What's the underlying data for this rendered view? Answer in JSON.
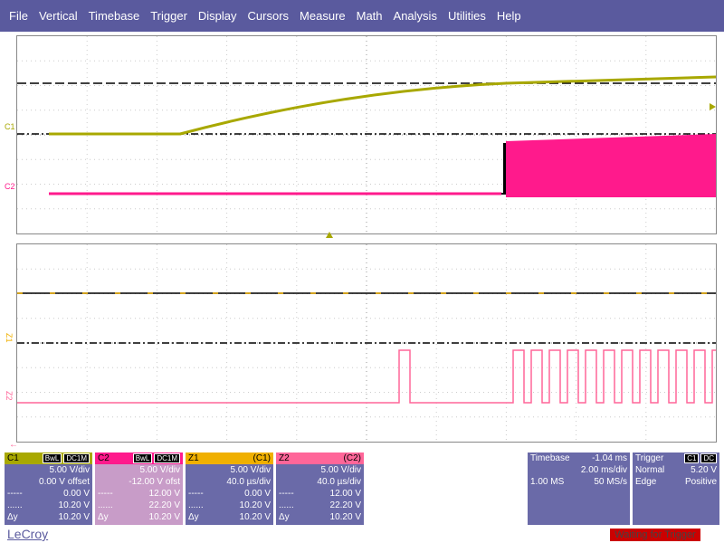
{
  "menu": [
    "File",
    "Vertical",
    "Timebase",
    "Trigger",
    "Display",
    "Cursors",
    "Measure",
    "Math",
    "Analysis",
    "Utilities",
    "Help"
  ],
  "labels": {
    "c1": "C1",
    "c2": "C2",
    "z1": "Z1",
    "z2": "Z2"
  },
  "colors": {
    "c1": "#a8a800",
    "c2": "#ff1a8c",
    "z1": "#f0b000",
    "z2": "#ff6699",
    "menu": "#5a5a9e"
  },
  "channels": [
    {
      "id": "c1",
      "title": "C1",
      "tags": [
        "BwL",
        "DC1M"
      ],
      "rows": [
        [
          "",
          "5.00 V/div"
        ],
        [
          "",
          "0.00 V offset"
        ],
        [
          "-----",
          "0.00 V"
        ],
        [
          "......",
          "10.20 V"
        ],
        [
          "Δy",
          "10.20 V"
        ]
      ]
    },
    {
      "id": "c2",
      "title": "C2",
      "tags": [
        "BwL",
        "DC1M"
      ],
      "rows": [
        [
          "",
          "5.00 V/div"
        ],
        [
          "",
          "-12.00 V ofst"
        ],
        [
          "-----",
          "12.00 V"
        ],
        [
          "......",
          "22.20 V"
        ],
        [
          "Δy",
          "10.20 V"
        ]
      ]
    },
    {
      "id": "z1",
      "title": "Z1",
      "src": "(C1)",
      "rows": [
        [
          "",
          "5.00 V/div"
        ],
        [
          "",
          "40.0 µs/div"
        ],
        [
          "-----",
          "0.00 V"
        ],
        [
          "......",
          "10.20 V"
        ],
        [
          "Δy",
          "10.20 V"
        ]
      ]
    },
    {
      "id": "z2",
      "title": "Z2",
      "src": "(C2)",
      "rows": [
        [
          "",
          "5.00 V/div"
        ],
        [
          "",
          "40.0 µs/div"
        ],
        [
          "-----",
          "12.00 V"
        ],
        [
          "......",
          "22.20 V"
        ],
        [
          "Δy",
          "10.20 V"
        ]
      ]
    }
  ],
  "timebase": {
    "label": "Timebase",
    "offset": "-1.04 ms",
    "div": "2.00 ms/div",
    "samples": "1.00 MS",
    "rate": "50 MS/s"
  },
  "trigger": {
    "label": "Trigger",
    "tags": [
      "C1",
      "DC"
    ],
    "mode": "Normal",
    "level": "5.20 V",
    "type": "Edge",
    "slope": "Positive"
  },
  "status": "Waiting for Trigger",
  "brand": "LeCroy"
}
